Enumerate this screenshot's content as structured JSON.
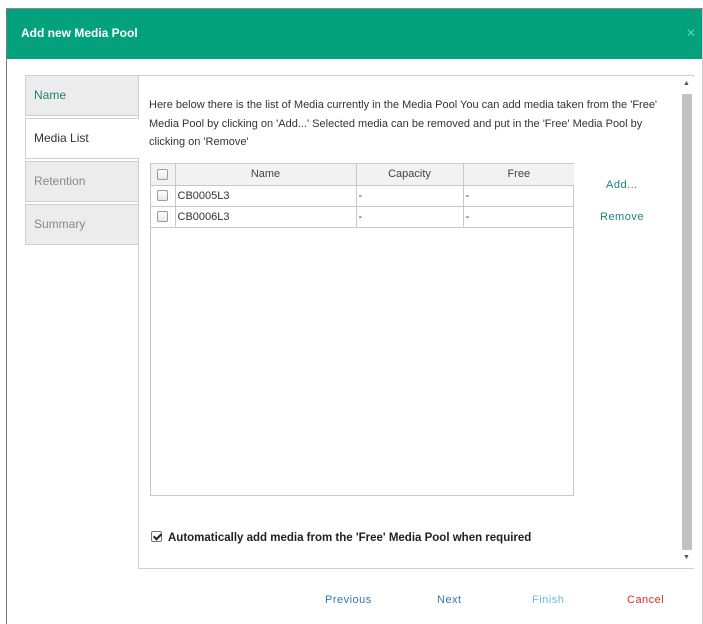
{
  "dialog": {
    "title": "Add new Media Pool",
    "close_icon": "close-icon",
    "colors": {
      "header": "#03a17c",
      "accent": "#16896d",
      "cancel": "#d9312b",
      "disabled": "#6fb8dc",
      "link": "#2f78b6"
    }
  },
  "nav": {
    "items": [
      {
        "label": "Name"
      },
      {
        "label": "Media List"
      },
      {
        "label": "Retention"
      },
      {
        "label": "Summary"
      }
    ]
  },
  "content": {
    "intro": "Here below there is the list of Media currently in the Media Pool You can add media taken from the 'Free' Media Pool by clicking on 'Add...' Selected media can be removed and put in the 'Free' Media Pool by clicking on 'Remove'",
    "table": {
      "headers": [
        "Name",
        "Capacity",
        "Free"
      ],
      "rows": [
        {
          "name": "CB0005L3",
          "capacity": "-",
          "free": "-"
        },
        {
          "name": "CB0006L3",
          "capacity": "-",
          "free": "-"
        }
      ]
    },
    "add_label": "Add...",
    "remove_label": "Remove",
    "auto_add_label": "Automatically add media from the 'Free' Media Pool when required",
    "auto_add_checked": true
  },
  "footer": {
    "previous_label": "Previous",
    "next_label": "Next",
    "finish_label": "Finish",
    "cancel_label": "Cancel"
  }
}
